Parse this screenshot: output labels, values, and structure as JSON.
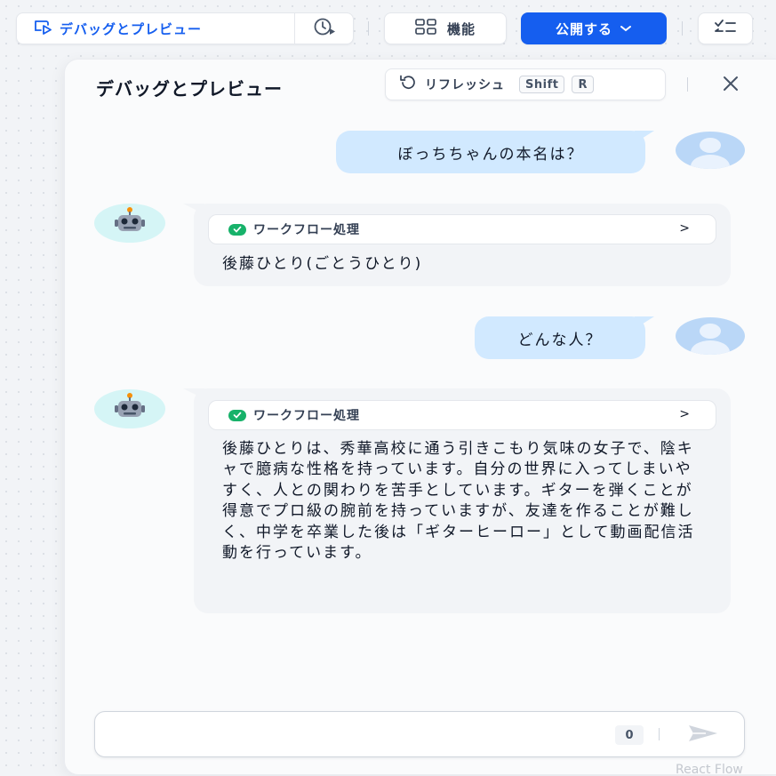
{
  "toolbar": {
    "debug_label": "デバッグとプレビュー",
    "features_label": "機能",
    "publish_label": "公開する"
  },
  "panel": {
    "title": "デバッグとプレビュー",
    "refresh_label": "リフレッシュ",
    "shortcut_key1": "Shift",
    "shortcut_key2": "R"
  },
  "chat": {
    "messages": [
      {
        "role": "user",
        "text": "ぼっちちゃんの本名は？"
      },
      {
        "role": "bot",
        "workflow_label": "ワークフロー処理",
        "chevron": ">",
        "text": "後藤ひとり(ごとうひとり)"
      },
      {
        "role": "user",
        "text": "どんな人？"
      },
      {
        "role": "bot",
        "workflow_label": "ワークフロー処理",
        "chevron": ">",
        "text": "後藤ひとりは、秀華高校に通う引きこもり気味の女子で、陰キャで臆病な性格を持っています。自分の世界に入ってしまいやすく、人との関わりを苦手としています。ギターを弾くことが得意でプロ級の腕前を持っていますが、友達を作ることが難しく、中学を卒業した後は「ギターヒーロー」として動画配信活動を行っています。"
      }
    ]
  },
  "input": {
    "value": "",
    "placeholder": "",
    "char_count": "0"
  },
  "watermark": "React Flow",
  "colors": {
    "primary": "#155eef",
    "success": "#17b26a",
    "user_bubble": "#d1e9ff",
    "bot_bubble": "#f2f4f7"
  }
}
